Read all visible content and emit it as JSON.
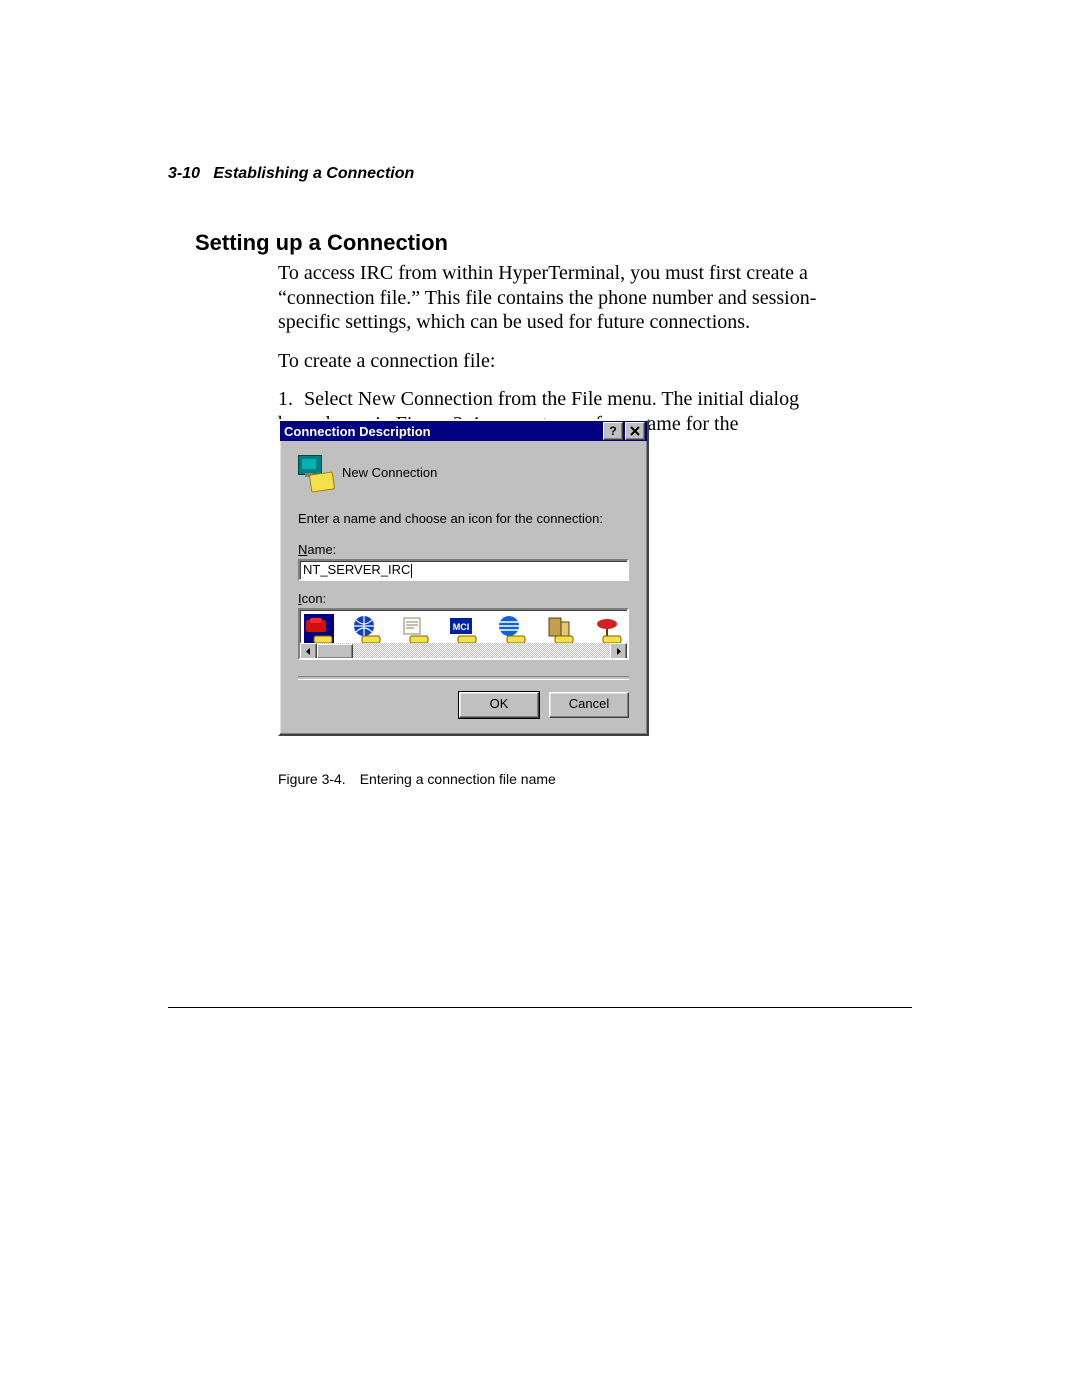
{
  "header": {
    "pageno": "3-10",
    "section": "Establishing a Connection"
  },
  "heading": "Setting up a Connection",
  "para1": "To access IRC from within HyperTerminal, you must first create a “connection file.” This file contains the phone number and session-specific settings, which can be used for future connections.",
  "para2": "To create a connection file:",
  "step1_num": "1.",
  "step1": "Select New Connection from the File menu. The initial dialog box, shown in Figure 3-4, prompts you for a name for the connection file.",
  "dialog": {
    "title": "Connection Description",
    "new_connection_label": "New Connection",
    "prompt": "Enter a name and choose an icon for the connection:",
    "name_label_u": "N",
    "name_label_rest": "ame:",
    "name_value": "NT_SERVER_IRC",
    "icon_label_u": "I",
    "icon_label_rest": "con:",
    "icons": [
      "red-phone-icon",
      "globe-phone-icon",
      "scroll-phone-icon",
      "mci-phone-icon",
      "att-phone-icon",
      "building-phone-icon",
      "satellite-phone-icon"
    ],
    "ok": "OK",
    "cancel": "Cancel"
  },
  "caption": {
    "label": "Figure 3-4.",
    "text": "Entering a connection file name"
  }
}
